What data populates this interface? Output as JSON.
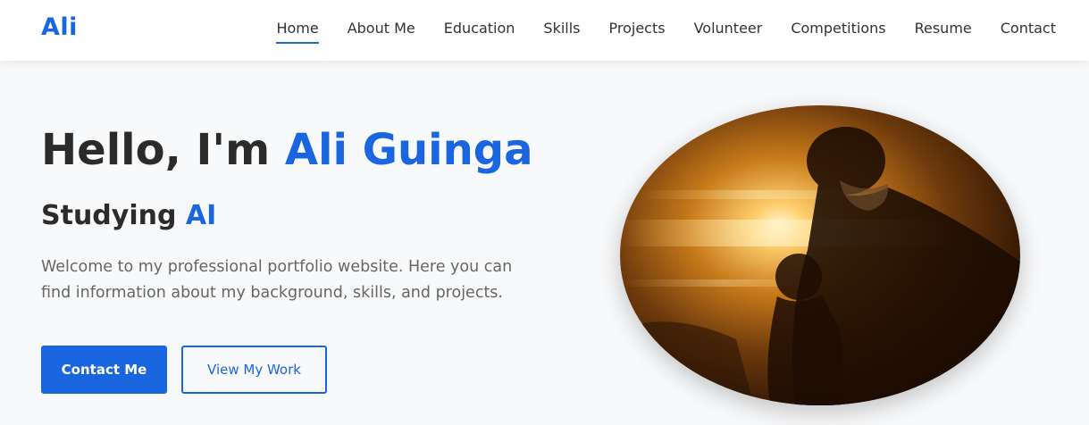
{
  "navbar": {
    "logo": "Ali",
    "links": [
      {
        "label": "Home",
        "active": true
      },
      {
        "label": "About Me"
      },
      {
        "label": "Education"
      },
      {
        "label": "Skills"
      },
      {
        "label": "Projects"
      },
      {
        "label": "Volunteer"
      },
      {
        "label": "Competitions"
      },
      {
        "label": "Resume"
      },
      {
        "label": "Contact"
      }
    ]
  },
  "hero": {
    "title_prefix": "Hello, I'm ",
    "title_name": "Ali Guinga",
    "subtitle_prefix": "Studying ",
    "subtitle_highlight": "AI",
    "description": "Welcome to my professional portfolio website. Here you can find information about my background, skills, and projects.",
    "primary_button": "Contact Me",
    "secondary_button": "View My Work"
  },
  "photo": {
    "icon": "profile-photo"
  },
  "colors": {
    "accent": "#1a66e0",
    "heading": "#2b2b2b",
    "body_text": "#666666",
    "nav_text": "#333333",
    "page_background": "#f8f9fa"
  }
}
